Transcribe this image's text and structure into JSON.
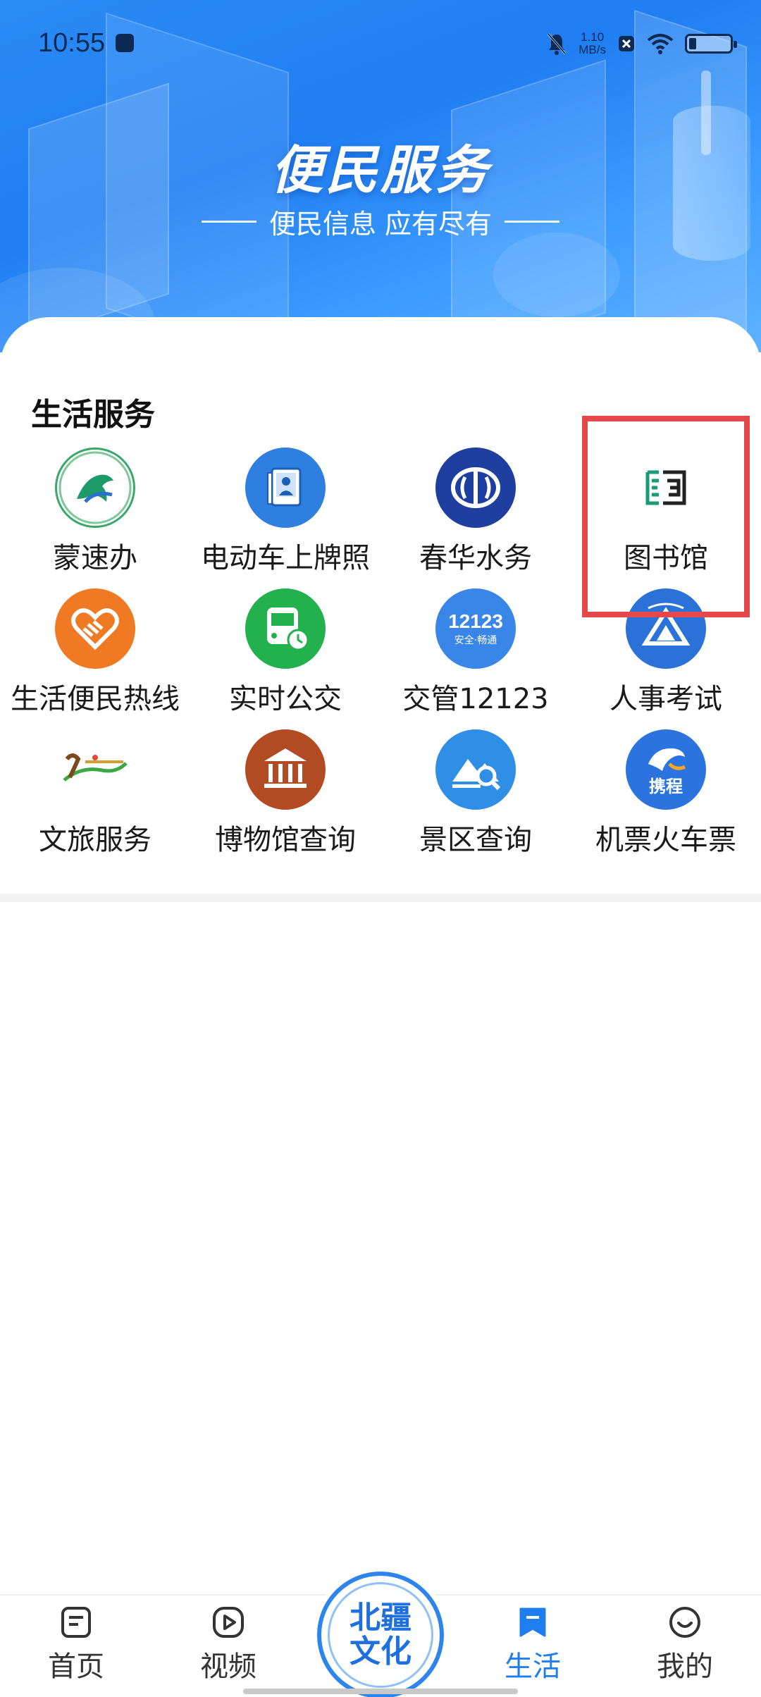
{
  "status_bar": {
    "time": "10:55",
    "speed_value": "1.10",
    "speed_unit": "MB/s"
  },
  "banner": {
    "title": "便民服务",
    "subtitle": "便民信息 应有尽有"
  },
  "section": {
    "title": "生活服务"
  },
  "services": [
    {
      "label": "蒙速办",
      "icon": "mengsuban-logo-icon",
      "color": "#ffffff"
    },
    {
      "label": "电动车上牌照",
      "icon": "license-card-icon",
      "color": "#2f7fe0"
    },
    {
      "label": "春华水务",
      "icon": "water-service-icon",
      "color": "#1f3fa0"
    },
    {
      "label": "图书馆",
      "icon": "library-icon",
      "color": "#ffffff"
    },
    {
      "label": "生活便民热线",
      "icon": "handshake-heart-icon",
      "color": "#f07a24"
    },
    {
      "label": "实时公交",
      "icon": "bus-clock-icon",
      "color": "#22b14c"
    },
    {
      "label": "交管12123",
      "icon": "traffic-12123-icon",
      "color": "#3a86e8"
    },
    {
      "label": "人事考试",
      "icon": "exam-tent-icon",
      "color": "#2a72d8"
    },
    {
      "label": "文旅服务",
      "icon": "culture-tourism-logo-icon",
      "color": "#ffffff"
    },
    {
      "label": "博物馆查询",
      "icon": "museum-icon",
      "color": "#b24a22"
    },
    {
      "label": "景区查询",
      "icon": "scenic-search-icon",
      "color": "#2f8ee6"
    },
    {
      "label": "机票火车票",
      "icon": "ctrip-dolphin-icon",
      "color": "#2b74e0"
    }
  ],
  "icon_texts": {
    "traffic_number": "12123",
    "traffic_slogan": "安全·畅通",
    "ctrip": "携程"
  },
  "bottom_nav": {
    "items": [
      {
        "label": "首页",
        "icon": "home-document-icon"
      },
      {
        "label": "视频",
        "icon": "video-play-icon"
      },
      {
        "label": "生活",
        "icon": "bookmark-icon",
        "active": true
      },
      {
        "label": "我的",
        "icon": "smile-profile-icon"
      }
    ],
    "center_line1": "北疆",
    "center_line2": "文化"
  },
  "colors": {
    "accent": "#1e7ef0",
    "highlight": "#e4484a"
  }
}
